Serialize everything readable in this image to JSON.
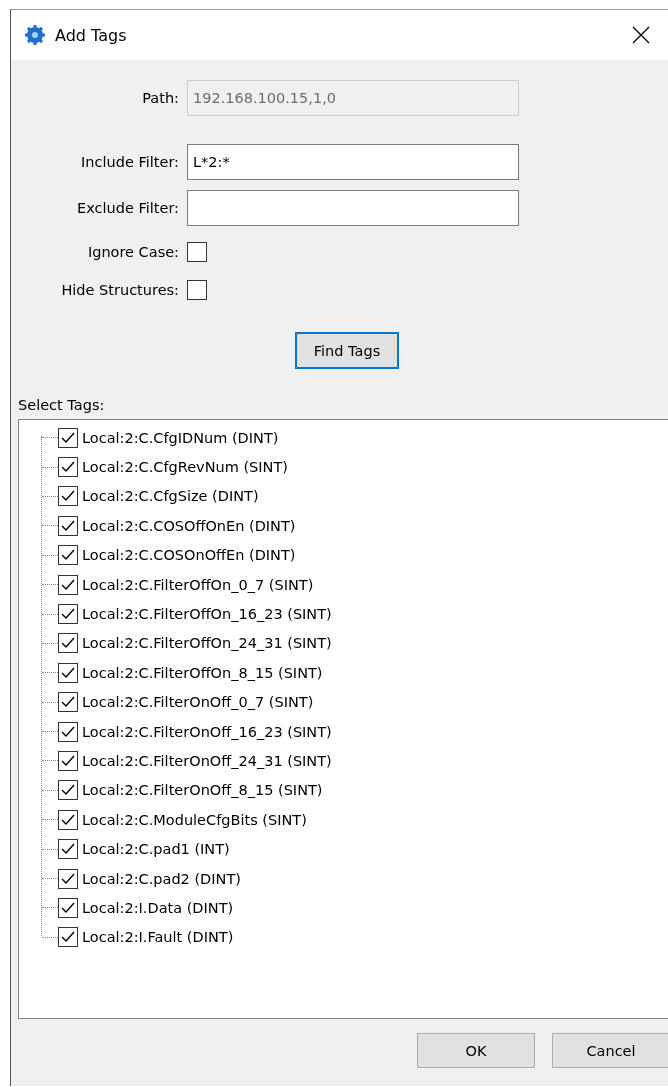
{
  "window": {
    "title": "Add Tags"
  },
  "form": {
    "path": {
      "label": "Path:",
      "value": "192.168.100.15,1,0",
      "disabled": true
    },
    "include_filter": {
      "label": "Include Filter:",
      "value": "L*2:*"
    },
    "exclude_filter": {
      "label": "Exclude Filter:"
    },
    "ignore_case": {
      "label": "Ignore Case:",
      "checked": false
    },
    "hide_structures": {
      "label": "Hide Structures:",
      "checked": false
    }
  },
  "find_button": {
    "label": "Find Tags",
    "focused": true
  },
  "select_tags": {
    "label": "Select Tags:",
    "items": [
      {
        "label": "Local:2:C.CfgIDNum (DINT)",
        "checked": true
      },
      {
        "label": "Local:2:C.CfgRevNum (SINT)",
        "checked": true
      },
      {
        "label": "Local:2:C.CfgSize (DINT)",
        "checked": true
      },
      {
        "label": "Local:2:C.COSOffOnEn (DINT)",
        "checked": true
      },
      {
        "label": "Local:2:C.COSOnOffEn (DINT)",
        "checked": true
      },
      {
        "label": "Local:2:C.FilterOffOn_0_7 (SINT)",
        "checked": true
      },
      {
        "label": "Local:2:C.FilterOffOn_16_23 (SINT)",
        "checked": true
      },
      {
        "label": "Local:2:C.FilterOffOn_24_31 (SINT)",
        "checked": true
      },
      {
        "label": "Local:2:C.FilterOffOn_8_15 (SINT)",
        "checked": true
      },
      {
        "label": "Local:2:C.FilterOnOff_0_7 (SINT)",
        "checked": true
      },
      {
        "label": "Local:2:C.FilterOnOff_16_23 (SINT)",
        "checked": true
      },
      {
        "label": "Local:2:C.FilterOnOff_24_31 (SINT)",
        "checked": true
      },
      {
        "label": "Local:2:C.FilterOnOff_8_15 (SINT)",
        "checked": true
      },
      {
        "label": "Local:2:C.ModuleCfgBits (SINT)",
        "checked": true
      },
      {
        "label": "Local:2:C.pad1 (INT)",
        "checked": true
      },
      {
        "label": "Local:2:C.pad2 (DINT)",
        "checked": true
      },
      {
        "label": "Local:2:I.Data (DINT)",
        "checked": true
      },
      {
        "label": "Local:2:I.Fault (DINT)",
        "checked": true
      }
    ]
  },
  "buttons": [
    "OK",
    "Cancel"
  ]
}
